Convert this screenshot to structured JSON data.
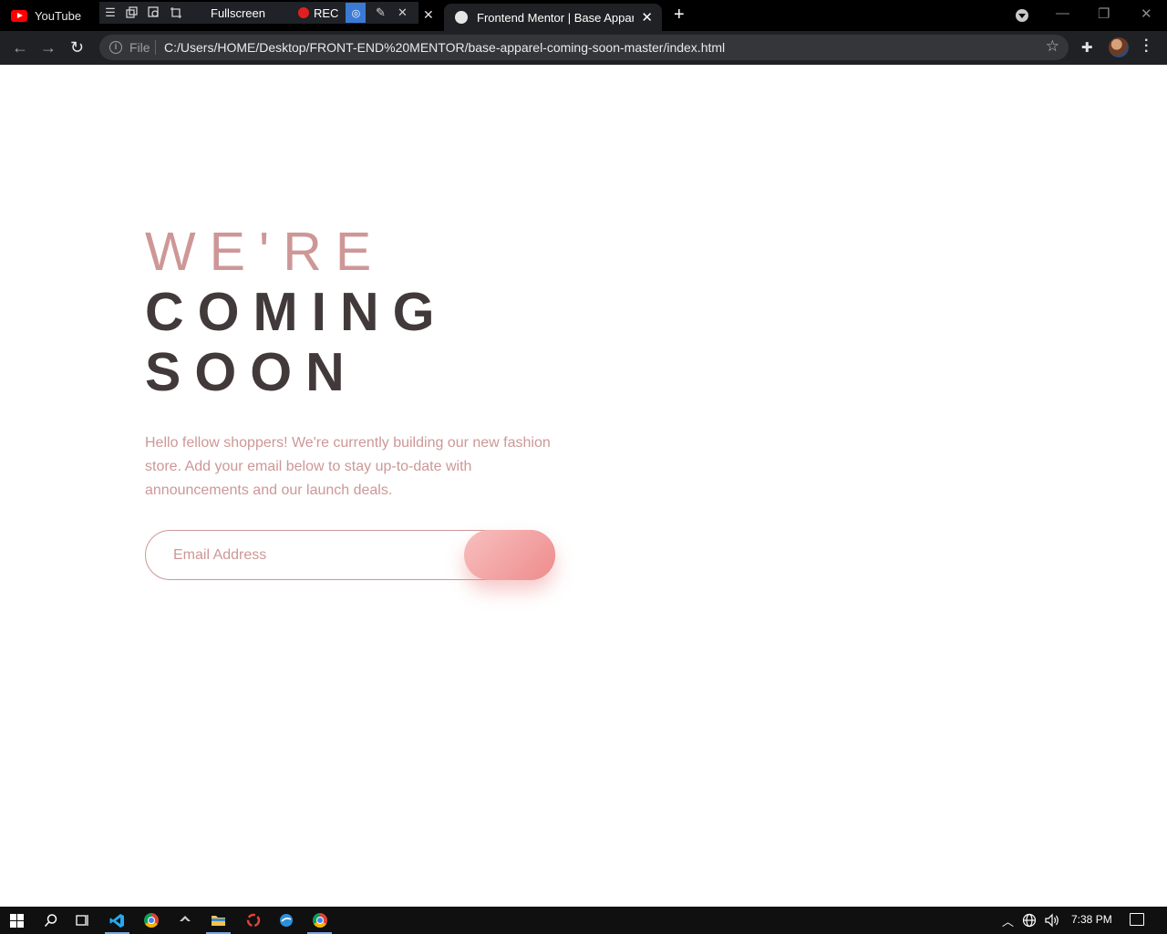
{
  "browser": {
    "pinned_tab_title": "YouTube",
    "recorder": {
      "fullscreen_label": "Fullscreen",
      "rec_label": "REC"
    },
    "active_tab_title": "Frontend Mentor | Base Apparel coming soon page",
    "new_tab_symbol": "+",
    "address": {
      "scheme_label": "File",
      "url": "C:/Users/HOME/Desktop/FRONT-END%20MENTOR/base-apparel-coming-soon-master/index.html"
    }
  },
  "page": {
    "headline_light": "WE'RE",
    "headline_dark_1": "COMING",
    "headline_dark_2": "SOON",
    "description": "Hello fellow shoppers! We're currently building our new fashion store. Add your email below to stay up-to-date with announcements and our launch deals.",
    "email_placeholder": "Email Address",
    "colors": {
      "accent_pink": "#ce9797",
      "heading_dark": "#423a3a",
      "gradient_start": "#f8bfbf",
      "gradient_end": "#ee8c8c"
    }
  },
  "taskbar": {
    "clock": "7:38 PM",
    "apps": [
      "windows-start",
      "search",
      "task-view",
      "vscode",
      "chrome",
      "app-unknown",
      "file-explorer",
      "app-red",
      "app-blue",
      "chrome-active"
    ]
  }
}
